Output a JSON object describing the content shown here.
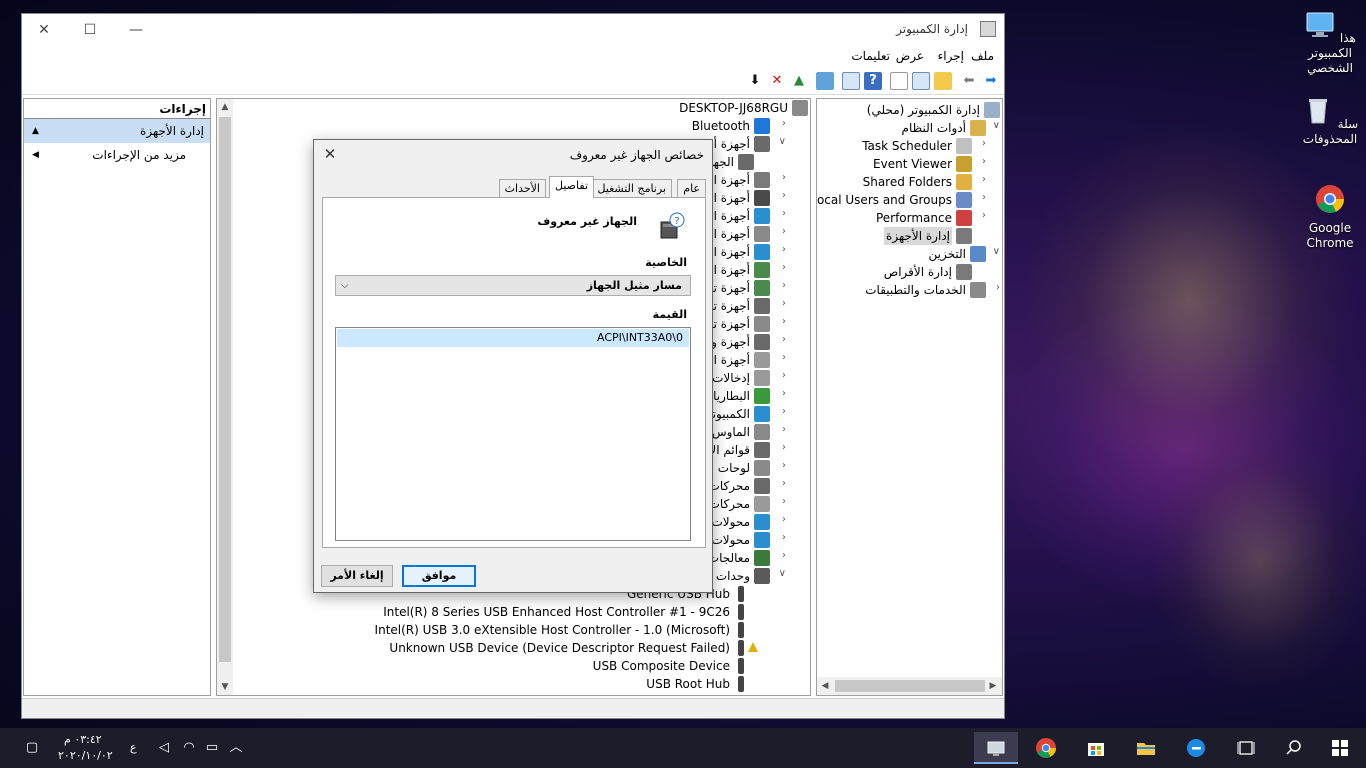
{
  "window": {
    "title": "إدارة الكمبيوتر",
    "controls": {
      "minimize": "—",
      "maximize": "☐",
      "close": "✕"
    }
  },
  "menu": [
    "ملف",
    "إجراء",
    "عرض",
    "تعليمات"
  ],
  "actions_pane": {
    "header": "إجراءات",
    "selected": "إدارة الأجهزة",
    "more": "مزيد من الإجراءات"
  },
  "device_manager": {
    "root": "DESKTOP-JJ68RGU",
    "categories": [
      {
        "label": "Bluetooth",
        "color": "#1e78d7"
      },
      {
        "label": "أجهزة أخرى",
        "color": "#6a6a6a"
      },
      {
        "label": "الجهاز غير معروف",
        "color": "#6a6a6a"
      },
      {
        "label": "أجهزة الصوت",
        "color": "#7a7a7a"
      },
      {
        "label": "أجهزة الطباعة",
        "color": "#4a4a4a"
      },
      {
        "label": "أجهزة العرض",
        "color": "#2a8fd0"
      },
      {
        "label": "أجهزة القياس",
        "color": "#8a8a8a"
      },
      {
        "label": "أجهزة الكمبيوتر",
        "color": "#2a8fd0"
      },
      {
        "label": "أجهزة التحكم",
        "color": "#4a8a4a"
      },
      {
        "label": "أجهزة تحكم",
        "color": "#4a8a4a"
      },
      {
        "label": "أجهزة تخزين",
        "color": "#6a6a6a"
      },
      {
        "label": "أجهزة تعريف",
        "color": "#8a8a8a"
      },
      {
        "label": "أجهزة واجهة",
        "color": "#6a6a6a"
      },
      {
        "label": "أجهزة الصوت",
        "color": "#9a9a9a"
      },
      {
        "label": "إدخالات",
        "color": "#9a9a9a"
      },
      {
        "label": "البطاريات",
        "color": "#3a9a3a"
      },
      {
        "label": "الكمبيوتر",
        "color": "#2a8fd0"
      },
      {
        "label": "الماوس",
        "color": "#8a8a8a"
      },
      {
        "label": "قوائم الانتظار",
        "color": "#6a6a6a"
      },
      {
        "label": "لوحات المفاتيح",
        "color": "#8a8a8a"
      },
      {
        "label": "محركات",
        "color": "#6a6a6a"
      },
      {
        "label": "محركات",
        "color": "#9a9a9a"
      },
      {
        "label": "محولات",
        "color": "#2a8fd0"
      },
      {
        "label": "محولات",
        "color": "#2a8fd0"
      },
      {
        "label": "معالجات",
        "color": "#3a7a3a"
      },
      {
        "label": "وحدات",
        "color": "#5a5a5a"
      }
    ],
    "usb_children": [
      "Generic USB Hub",
      "Intel(R) 8 Series USB Enhanced Host Controller #1 - 9C26",
      "Intel(R) USB 3.0 eXtensible Host Controller - 1.0 (Microsoft)",
      "Unknown USB Device (Device Descriptor Request Failed)",
      "USB Composite Device",
      "USB Root Hub"
    ]
  },
  "tree": [
    {
      "label": "إدارة الكمبيوتر (محلي)",
      "indent": 0
    },
    {
      "label": "أدوات النظام",
      "indent": 1
    },
    {
      "label": "Task Scheduler",
      "indent": 2
    },
    {
      "label": "Event Viewer",
      "indent": 2
    },
    {
      "label": "Shared Folders",
      "indent": 2
    },
    {
      "label": "Local Users and Groups",
      "indent": 2
    },
    {
      "label": "Performance",
      "indent": 2
    },
    {
      "label": "إدارة الأجهزة",
      "indent": 2
    },
    {
      "label": "التخزين",
      "indent": 1
    },
    {
      "label": "إدارة الأقراص",
      "indent": 2
    },
    {
      "label": "الخدمات والتطبيقات",
      "indent": 1
    }
  ],
  "dialog": {
    "title": "خصائص الجهاز غير معروف",
    "tabs": [
      "عام",
      "برنامج التشغيل",
      "تفاصيل",
      "الأحداث"
    ],
    "active_tab": "تفاصيل",
    "device_name": "الجهاز غير معروف",
    "property_label": "الخاصية",
    "property_value": "مسار مثيل الجهاز",
    "value_label": "القيمة",
    "value_item": "ACPI\\INT33A0\\0",
    "ok": "موافق",
    "cancel": "إلغاء الأمر"
  },
  "desktop": {
    "icons": [
      "هذا الكمبيوتر الشخصي",
      "سلة المحذوفات",
      "Google Chrome"
    ]
  },
  "taskbar": {
    "time": "٠٣:٤٢ م",
    "date": "٢٠٢٠/١٠/٠٢",
    "lang": "ع"
  },
  "colors": {
    "accent": "#0078d7",
    "selection": "#cce8ff",
    "taskbar": "#1c1c2a"
  }
}
